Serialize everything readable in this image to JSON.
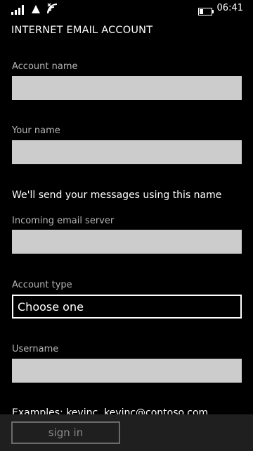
{
  "status_bar": {
    "time": "06:41",
    "icons": [
      "signal-bars-icon",
      "data-triangle-icon",
      "wifi-icon",
      "battery-icon"
    ]
  },
  "page": {
    "title": "INTERNET EMAIL ACCOUNT"
  },
  "form": {
    "account_name_label": "Account name",
    "account_name_value": "",
    "your_name_label": "Your name",
    "your_name_value": "",
    "send_info": "We'll send your messages using this name",
    "incoming_server_label": "Incoming email server",
    "incoming_server_value": "",
    "account_type_label": "Account type",
    "account_type_value": "Choose one",
    "username_label": "Username",
    "username_value": "",
    "examples": "Examples: kevinc, kevinc@contoso.com"
  },
  "app_bar": {
    "sign_in_label": "sign in"
  },
  "colors": {
    "background": "#000000",
    "field": "#cccccc",
    "label": "#b5b5b5",
    "app_bar": "#1f1f1f",
    "button_disabled": "#8a8a8a"
  }
}
